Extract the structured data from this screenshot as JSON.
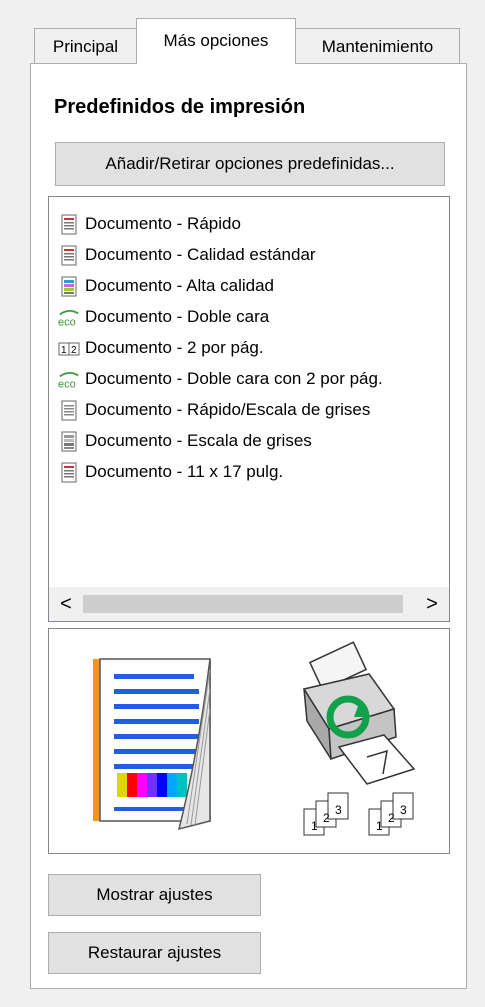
{
  "tabs": [
    {
      "label": "Principal"
    },
    {
      "label": "Más opciones"
    },
    {
      "label": "Mantenimiento"
    }
  ],
  "section_title": "Predefinidos de impresión",
  "presets_button": "Añadir/Retirar opciones predefinidas...",
  "presets": [
    {
      "label": "Documento - Rápido",
      "icon": "document-icon"
    },
    {
      "label": "Documento - Calidad estándar",
      "icon": "document-icon"
    },
    {
      "label": "Documento - Alta calidad",
      "icon": "document-high-quality-icon"
    },
    {
      "label": "Documento - Doble cara",
      "icon": "eco-icon",
      "icon_text": "eco"
    },
    {
      "label": "Documento - 2 por pág.",
      "icon": "two-per-page-icon",
      "icon_text": "12"
    },
    {
      "label": "Documento - Doble cara con 2 por pág.",
      "icon": "eco-icon",
      "icon_text": "eco"
    },
    {
      "label": "Documento - Rápido/Escala de grises",
      "icon": "grayscale-document-icon"
    },
    {
      "label": "Documento - Escala de grises",
      "icon": "grayscale-document-icon"
    },
    {
      "label": "Documento - 11 x 17 pulg.",
      "icon": "document-icon"
    }
  ],
  "scrollbar": {
    "left_arrow": "<",
    "right_arrow": ">"
  },
  "preview": {
    "collate_labels": [
      "1",
      "2",
      "3"
    ]
  },
  "buttons": {
    "show_settings": "Mostrar ajustes",
    "restore_settings": "Restaurar ajustes"
  },
  "colors": {
    "eco_green": "#3a9a3a",
    "accent_orange": "#f7941d",
    "page_lines_blue": "#1f5fe0",
    "rotate_arrow_green": "#12a04a"
  }
}
